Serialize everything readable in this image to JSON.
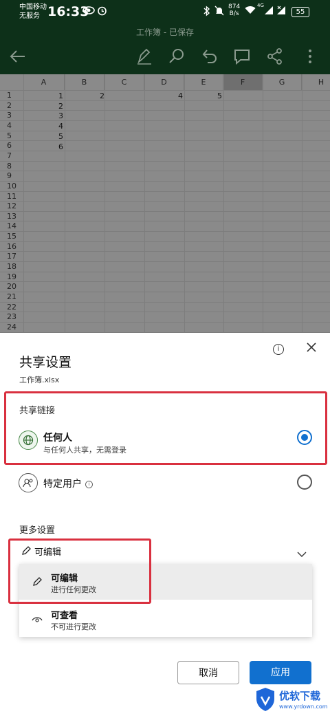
{
  "status_bar": {
    "carrier_line1": "中国移动",
    "carrier_line2": "无服务",
    "time": "16:33",
    "net_speed_value": "874",
    "net_speed_unit": "B/s",
    "network": "4G",
    "battery": "55"
  },
  "app_bar": {
    "title": "工作簿 - 已保存",
    "icons": [
      "back-arrow-icon",
      "pen-icon",
      "search-icon",
      "undo-icon",
      "comment-icon",
      "share-icon",
      "more-icon"
    ]
  },
  "sheet": {
    "columns": [
      "A",
      "B",
      "C",
      "D",
      "E",
      "F",
      "G",
      "H"
    ],
    "rows": [
      "1",
      "2",
      "3",
      "4",
      "5",
      "6",
      "7",
      "8",
      "9",
      "10",
      "11",
      "12",
      "13",
      "14",
      "15",
      "16",
      "17",
      "18",
      "19",
      "20",
      "21",
      "22",
      "23",
      "24"
    ],
    "cells": {
      "A1": "1",
      "A2": "2",
      "A3": "3",
      "A4": "4",
      "A5": "5",
      "A6": "6",
      "B1": "2",
      "D1": "4",
      "E1": "5"
    },
    "selected_column": "F"
  },
  "share_panel": {
    "title": "共享设置",
    "file_name": "工作簿.xlsx",
    "link_section_label": "共享链接",
    "options": [
      {
        "title": "任何人",
        "subtitle": "与任何人共享，无需登录",
        "selected": true
      },
      {
        "title": "特定用户",
        "subtitle": "",
        "selected": false
      }
    ],
    "more_settings_label": "更多设置",
    "permission_value": "可编辑",
    "permission_options": [
      {
        "title": "可编辑",
        "subtitle": "进行任何更改",
        "selected": true
      },
      {
        "title": "可查看",
        "subtitle": "不可进行更改",
        "selected": false
      }
    ],
    "cancel_label": "取消",
    "apply_label": "应用"
  },
  "watermark": {
    "brand": "优软下载",
    "url": "www.yrdown.com"
  },
  "colors": {
    "app_bar": "#0d3019",
    "accent": "#1170cf",
    "highlight": "#d9303f"
  }
}
